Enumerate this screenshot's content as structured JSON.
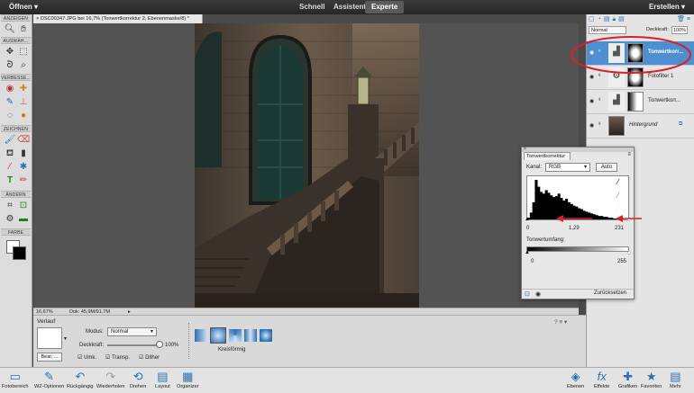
{
  "topbar": {
    "open": "Öffnen",
    "modes": [
      "Schnell",
      "Assistent",
      "Experte"
    ],
    "create": "Erstellen"
  },
  "toolbox": {
    "sections": [
      "ANZEIGEN",
      "AUSWÄH...",
      "VERBESSE...",
      "ZEICHNEN",
      "ÄNDERN",
      "FARBE"
    ]
  },
  "document": {
    "tab": "DSC00347.JPG bei 16,7% (Tonwertkorrektur 2, Ebenenmaske/8) *",
    "zoom": "16,67%",
    "doc_size": "Dok: 45,9M/91,7M"
  },
  "options_bar": {
    "tool_name": "Verlauf",
    "edit_button": "Bear. ...",
    "mode_label": "Modus:",
    "mode_value": "Normal",
    "opacity_label": "Deckkraft:",
    "opacity_value": "100%",
    "opacity_fraction": 1.0,
    "checkboxes": [
      "Umk.",
      "Transp.",
      "Dither"
    ],
    "gradient_style_label": "Kreisförmig"
  },
  "layers_panel": {
    "blend_mode": "Normal",
    "opacity_label": "Deckkraft:",
    "opacity_value": "100%",
    "layers": [
      {
        "name": "Tonwertkorr...",
        "selected": true
      },
      {
        "name": "Fotofilter 1",
        "selected": false
      },
      {
        "name": "Tonwertkorr...",
        "selected": false
      },
      {
        "name": "Hintergrund",
        "selected": false
      }
    ]
  },
  "levels_dialog": {
    "tab": "Tonwertkorrektur",
    "channel_label": "Kanal:",
    "channel_value": "RGB",
    "auto_button": "Auto",
    "input_black": "0",
    "input_gamma": "1,29",
    "input_white": "231",
    "output_label": "Tonwertumfang:",
    "output_black": "0",
    "output_white": "255",
    "reset_button": "Zurücksetzen",
    "histogram": [
      2,
      8,
      20,
      46,
      38,
      32,
      30,
      34,
      31,
      28,
      26,
      27,
      30,
      25,
      22,
      24,
      20,
      18,
      16,
      15,
      13,
      12,
      10,
      9,
      8,
      7,
      6,
      5,
      4,
      4,
      3,
      3,
      2,
      2,
      1,
      1,
      1,
      1,
      0,
      0
    ]
  },
  "bottombar": {
    "buttons": [
      "Fotobereich",
      "WZ-Optionen",
      "Rückgängig",
      "Wiederholen",
      "Drehen",
      "Layout",
      "Organizer"
    ],
    "right_buttons": [
      "Ebenen",
      "Effekte",
      "Grafiken",
      "Favoriten",
      "Mehr"
    ]
  },
  "colors": {
    "accent": "#4d8fd1",
    "highlight_ring": "#d9202a"
  }
}
